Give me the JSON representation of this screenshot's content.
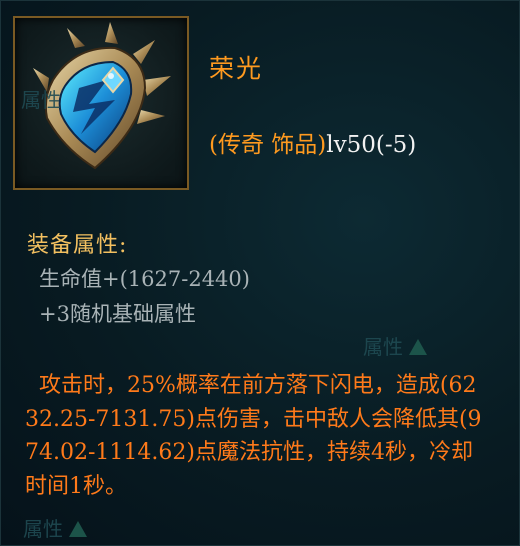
{
  "item": {
    "name": "荣光",
    "type_prefix": "(传奇 饰品)",
    "type_level": "lv50(-5)",
    "icon": "shield-ornament-icon"
  },
  "attributes": {
    "title": "装备属性:",
    "lines": [
      "生命值+(1627-2440)",
      "+3随机基础属性"
    ]
  },
  "skill": {
    "text": "攻击时，25%概率在前方落下闪电，造成(6232.25-7131.75)点伤害，击中敌人会降低其(974.02-1114.62)点魔法抗性，持续4秒，冷却时间1秒。"
  },
  "watermark": {
    "text": "属性"
  },
  "colors": {
    "legendary_orange": "#ff9a1f",
    "section_gold": "#f3c060",
    "stat_gray": "#a9b3b6",
    "skill_orange": "#ff7a1a",
    "background": "#07161c"
  }
}
